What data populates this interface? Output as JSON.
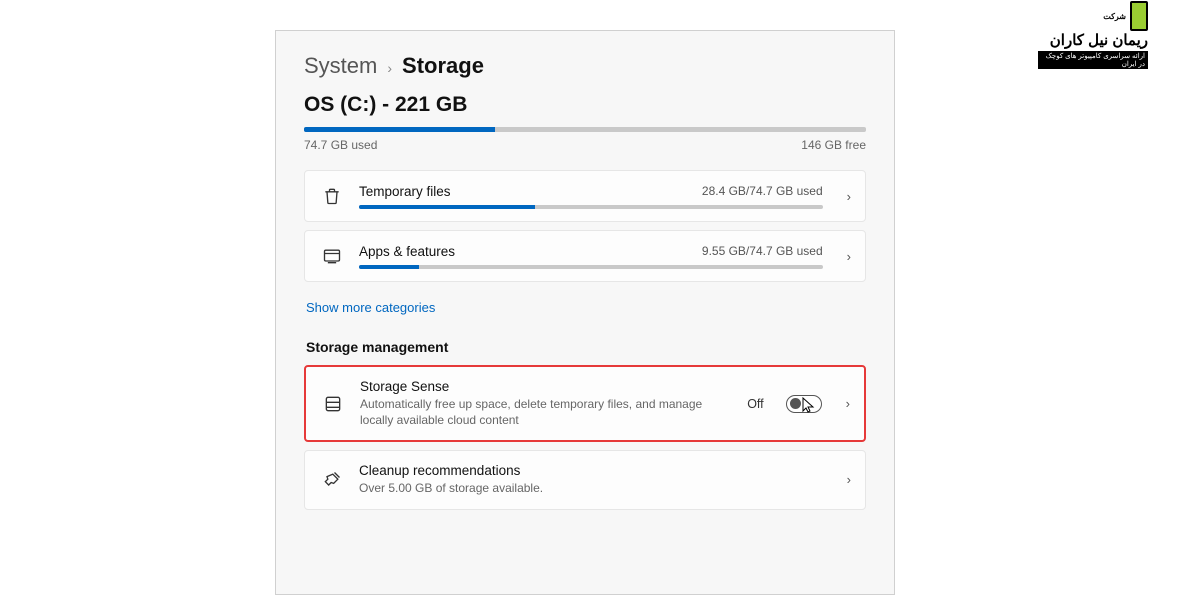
{
  "breadcrumb": {
    "parent": "System",
    "current": "Storage"
  },
  "drive": {
    "title": "OS (C:) - 221 GB",
    "used_label": "74.7 GB used",
    "free_label": "146 GB free",
    "used_pct": 34
  },
  "categories": [
    {
      "icon": "trash",
      "title": "Temporary files",
      "usage": "28.4 GB/74.7 GB used",
      "pct": 38
    },
    {
      "icon": "apps",
      "title": "Apps & features",
      "usage": "9.55 GB/74.7 GB used",
      "pct": 13
    }
  ],
  "show_more": "Show more categories",
  "section": "Storage management",
  "sense": {
    "title": "Storage Sense",
    "desc": "Automatically free up space, delete temporary files, and manage locally available cloud content",
    "state": "Off"
  },
  "cleanup": {
    "title": "Cleanup recommendations",
    "desc": "Over 5.00 GB of storage available."
  },
  "watermark": {
    "line1": "شرکت",
    "line2": "ریمان نیل کاران",
    "line3": "ارائه سراسری کامپیوتر های کوچک در ایران"
  }
}
